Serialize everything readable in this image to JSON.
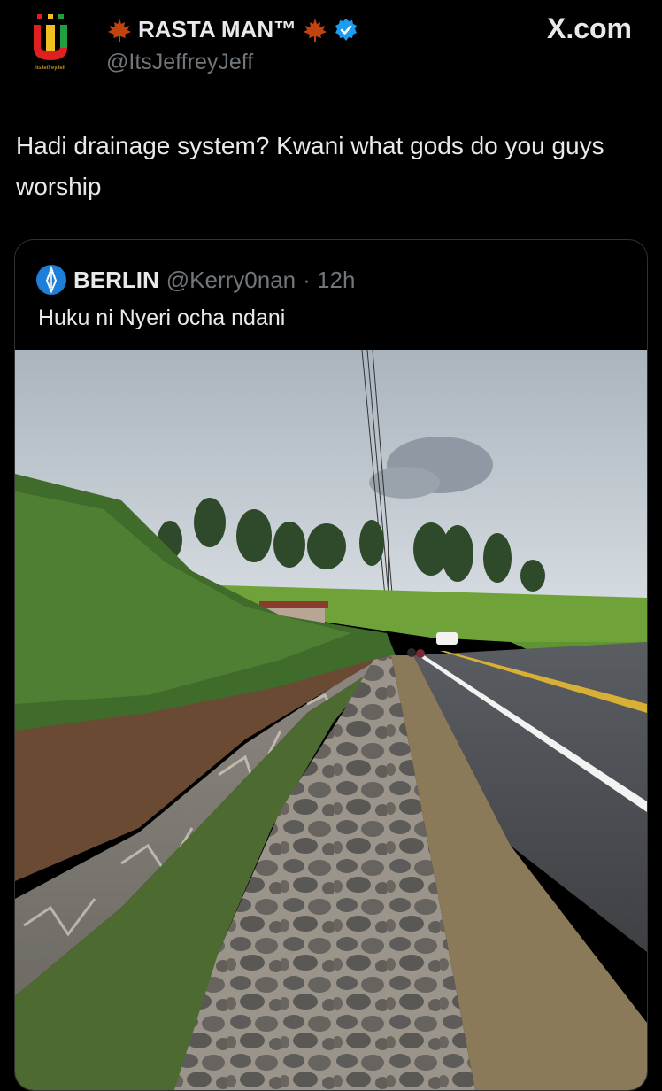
{
  "author": {
    "display_name": "RASTA MAN™",
    "handle": "@ItsJeffreyJeff",
    "avatar_text": "ItsJeffreyJeff",
    "verified": true
  },
  "site_label": "X.com",
  "tweet": {
    "text": "Hadi drainage system? Kwani what gods do you guys worship"
  },
  "quoted": {
    "display_name": "BERLIN",
    "handle": "@Kerry0nan",
    "time": "· 12h",
    "text": "Huku ni Nyeri ocha ndani"
  },
  "colors": {
    "background": "#000000",
    "text": "#e7e9ea",
    "muted": "#71767b",
    "verified": "#1d9bf0",
    "maple": "#c1440e"
  },
  "icons": [
    "maple-leaf-icon",
    "verified-badge-icon",
    "spear-avatar-icon"
  ]
}
